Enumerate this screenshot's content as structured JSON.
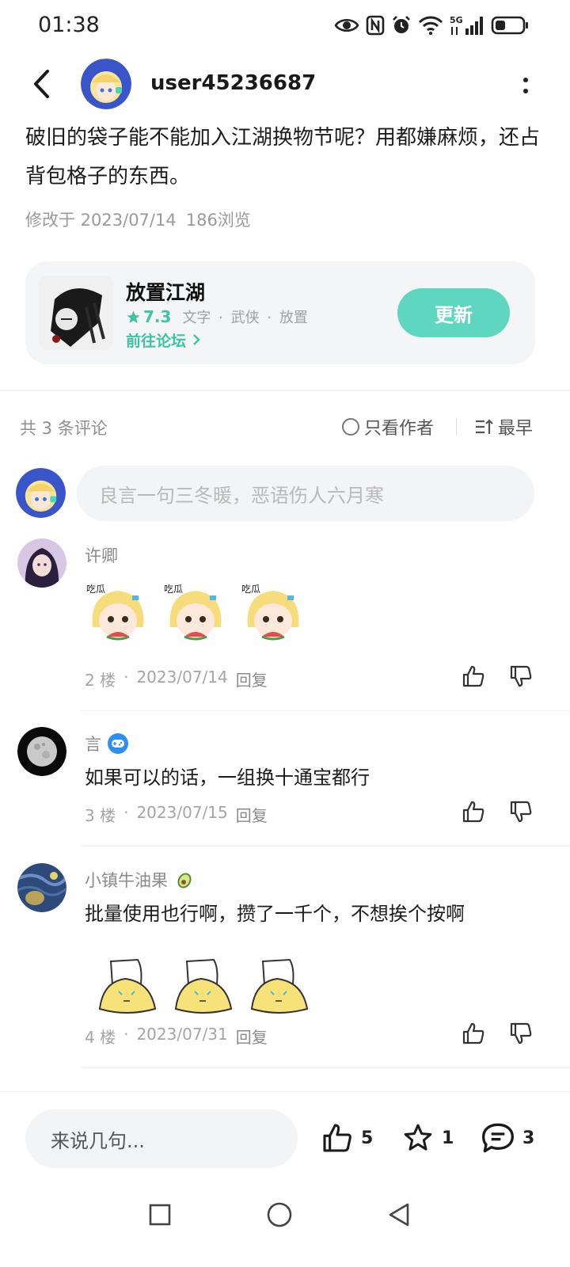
{
  "status_bar": {
    "time": "01:38",
    "icons": [
      "eye-icon",
      "nfc-icon",
      "alarm-icon",
      "wifi-icon",
      "signal-5g-icon",
      "battery-icon"
    ],
    "network_label": "5G"
  },
  "header": {
    "username": "user45236687",
    "icons": [
      "back-arrow-icon",
      "more-vertical-icon"
    ]
  },
  "post": {
    "text": "破旧的袋子能不能加入江湖换物节呢？用都嫌麻烦，还占背包格子的东西。",
    "modified": "修改于 2023/07/14",
    "views": "186浏览"
  },
  "game": {
    "name": "放置江湖",
    "rating": "7.3",
    "tags": [
      "文字",
      "武侠",
      "放置"
    ],
    "tag_separator": "·",
    "forum_link": "前往论坛",
    "update_label": "更新",
    "accent_color": "#3cc5a4",
    "button_color": "#5fd6c0"
  },
  "comments_header": {
    "count_label": "共 3 条评论",
    "author_only_label": "只看作者",
    "sort_label": "最早"
  },
  "comment_input": {
    "placeholder": "良言一句三冬暖，恶语伤人六月寒"
  },
  "comments": [
    {
      "name": "许卿",
      "text": "",
      "floor": "2 楼",
      "date": "2023/07/14",
      "reply": "回复",
      "sticker_count": 3,
      "sticker_text": "吃瓜"
    },
    {
      "name": "言",
      "badge": "gamepad-badge-icon",
      "text": "如果可以的话，一组换十通宝都行",
      "floor": "3 楼",
      "date": "2023/07/15",
      "reply": "回复",
      "sticker_count": 0
    },
    {
      "name": "小镇牛油果",
      "name_emoji": "avocado-icon",
      "text": "批量使用也行啊，攒了一千个，不想挨个按啊",
      "floor": "4 楼",
      "date": "2023/07/31",
      "reply": "回复",
      "sticker_count": 3
    }
  ],
  "bottom_bar": {
    "input_placeholder": "来说几句...",
    "likes": "5",
    "favorites": "1",
    "comments": "3"
  },
  "nav_bar": {
    "icons": [
      "recent-apps-icon",
      "home-icon",
      "back-triangle-icon"
    ]
  }
}
